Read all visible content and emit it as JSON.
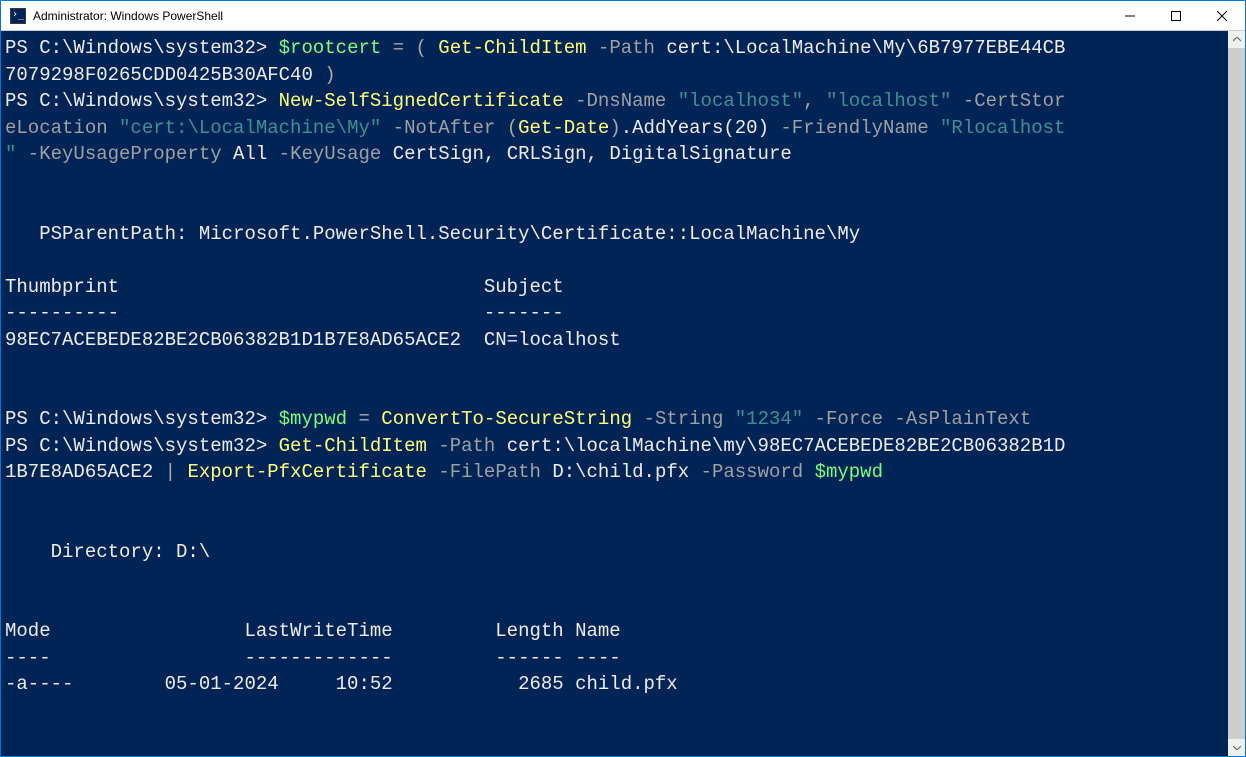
{
  "window": {
    "title": "Administrator: Windows PowerShell"
  },
  "prompt": "PS C:\\Windows\\system32> ",
  "c1": {
    "var": "$rootcert",
    "eq": " = ( ",
    "cmd": "Get-ChildItem",
    "p1": " -Path",
    "path": " cert:\\LocalMachine\\My\\6B7977EBE44CB",
    "path2": "7079298F0265CDD0425B30AFC40",
    "close": " )"
  },
  "c2": {
    "cmd": "New-SelfSignedCertificate",
    "dns": " -DnsName ",
    "s1": "\"localhost\"",
    "comma": ", ",
    "s2": "\"localhost\"",
    "csl": " -CertStor",
    "csl2a": "eLocation ",
    "csl2b": "\"cert:\\LocalMachine\\My\"",
    "na": " -NotAfter ",
    "lp": "(",
    "gd": "Get-Date",
    "rp": ")",
    "ay": ".AddYears(",
    "n20": "20",
    "rp2": ")",
    "fn": " -FriendlyName ",
    "fnv": "\"Rlocalhost",
    "fnv2": "\"",
    "kup": " -KeyUsageProperty ",
    "all": "All",
    "ku": " -KeyUsage ",
    "kuv": "CertSign, CRLSign, DigitalSignature"
  },
  "out1": {
    "blank": "",
    "pp": "   PSParentPath: Microsoft.PowerShell.Security\\Certificate::LocalMachine\\My",
    "hdr": "Thumbprint                                Subject",
    "sep": "----------                                -------",
    "row": "98EC7ACEBEDE82BE2CB06382B1D1B7E8AD65ACE2  CN=localhost"
  },
  "c3": {
    "var": "$mypwd",
    "eq": " = ",
    "cmd": "ConvertTo-SecureString",
    "sp": " -String ",
    "sv": "\"1234\"",
    "f": " -Force",
    "apt": " -AsPlainText"
  },
  "c4": {
    "cmd": "Get-ChildItem",
    "p": " -Path ",
    "pv": "cert:\\localMachine\\my\\98EC7ACEBEDE82BE2CB06382B1D",
    "pv2": "1B7E8AD65ACE2",
    "pipe": " | ",
    "cmd2": "Export-PfxCertificate",
    "fp": " -FilePath ",
    "fpv": "D:\\child.pfx",
    "pw": " -Password ",
    "pwv": "$mypwd"
  },
  "out2": {
    "dir": "    Directory: D:\\",
    "hdr": "Mode                 LastWriteTime         Length Name",
    "sep": "----                 -------------         ------ ----",
    "row": "-a----        05-01-2024     10:52           2685 child.pfx"
  }
}
